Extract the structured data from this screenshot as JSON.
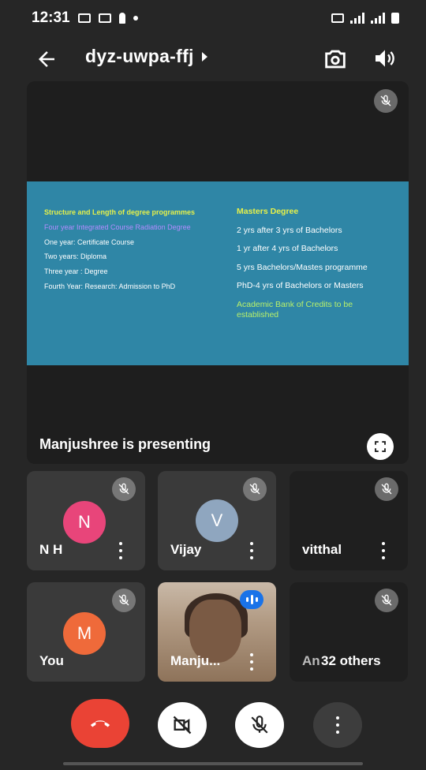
{
  "status_bar": {
    "time": "12:31"
  },
  "header": {
    "meeting_code": "dyz-uwpa-ffj"
  },
  "presentation": {
    "presenting_label": "Manjushree is presenting",
    "slide": {
      "left": {
        "heading": "Structure and Length of degree programmes",
        "subheading": "Four year Integrated Course Radiation Degree",
        "items": [
          "One year: Certificate Course",
          "Two years: Diploma",
          "Three year : Degree",
          "Fourth Year: Research: Admission to PhD"
        ]
      },
      "right": {
        "heading": "Masters Degree",
        "items": [
          "2 yrs after 3 yrs of Bachelors",
          "1 yr after 4 yrs of Bachelors",
          "5 yrs Bachelors/Mastes programme",
          "PhD-4 yrs of Bachelors or Masters"
        ],
        "footer": "Academic Bank of Credits to be established"
      }
    }
  },
  "participants": [
    {
      "name": "N H",
      "initial": "N",
      "avatar_color": "#e8457a"
    },
    {
      "name": "Vijay",
      "initial": "V",
      "avatar_color": "#8fa6bf"
    },
    {
      "name": "vitthal"
    },
    {
      "name": "You",
      "initial": "M",
      "avatar_color": "#ef6a3a"
    },
    {
      "name": "Manju..."
    },
    {
      "name": "An",
      "overlay": "32 others"
    }
  ],
  "colors": {
    "end_call": "#ea4335",
    "speaking": "#1a73e8"
  }
}
